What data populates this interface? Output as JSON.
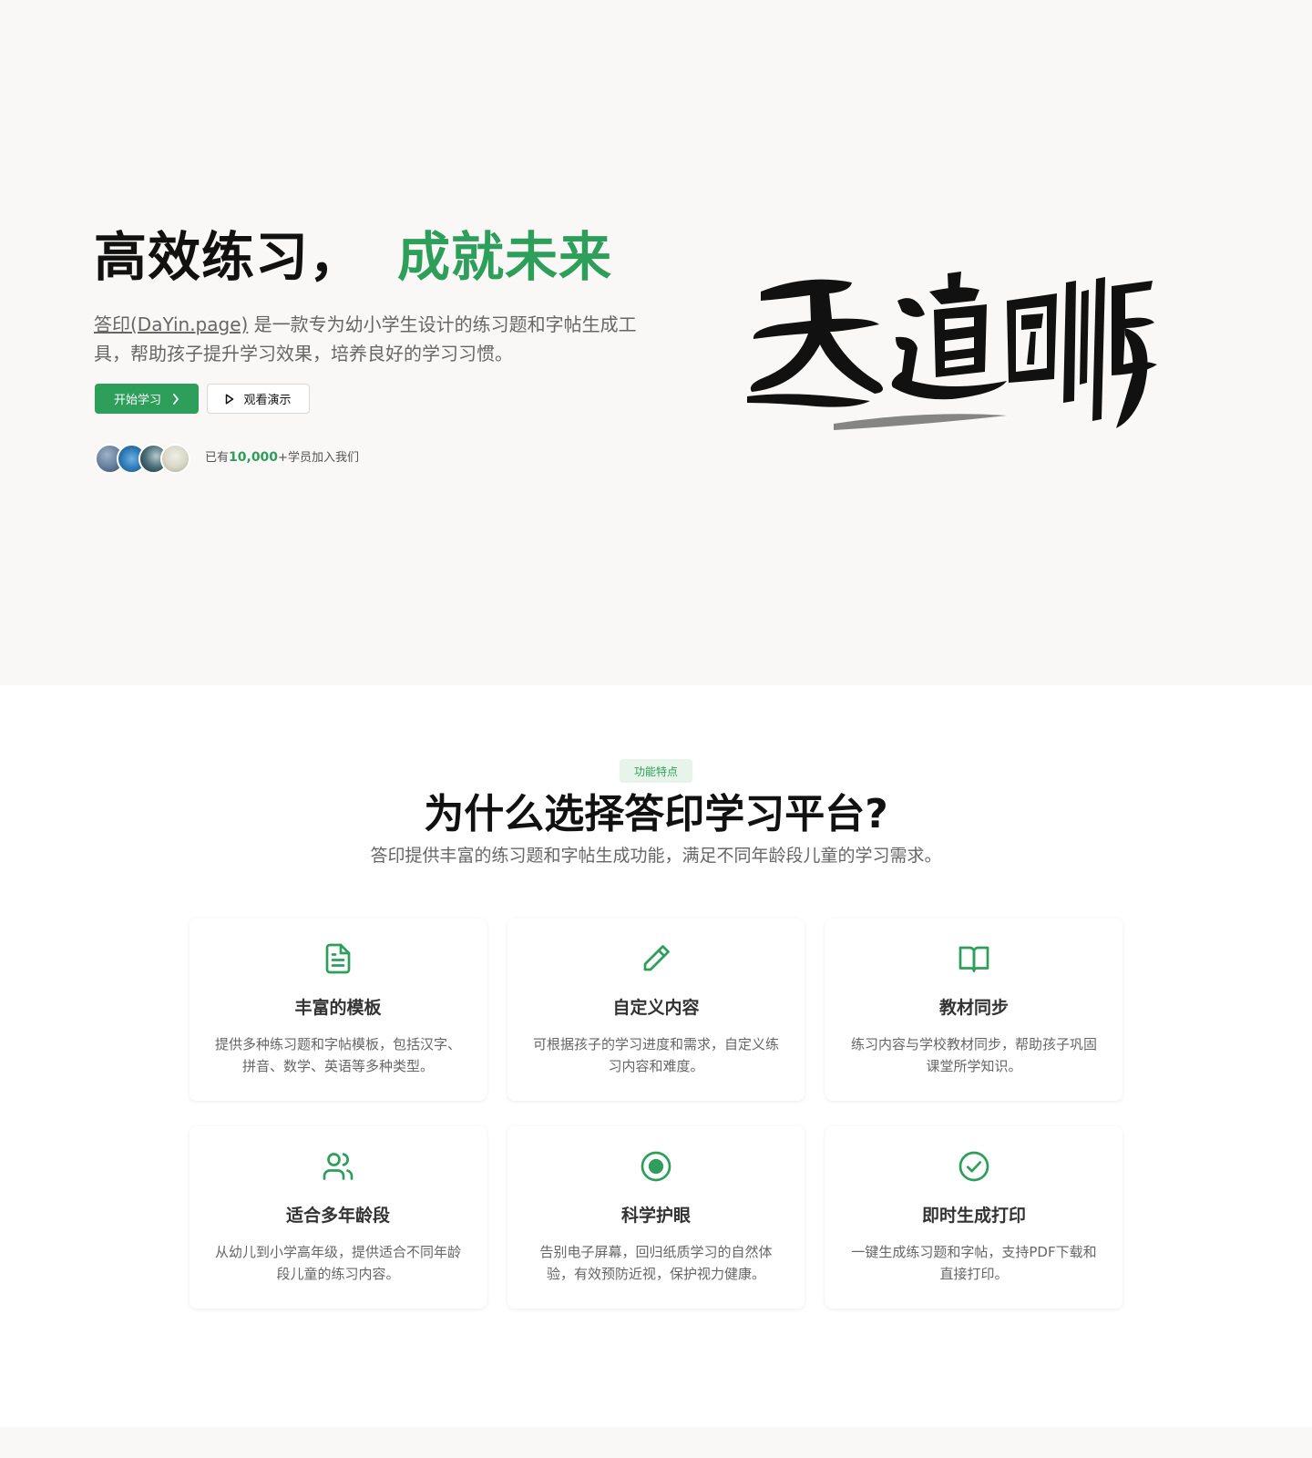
{
  "hero": {
    "title_main": "高效练习，",
    "title_accent": "成就未来",
    "brand_link": "答印(DaYin.page)",
    "description": " 是一款专为幼小学生设计的练习题和字帖生成工具，帮助孩子提升学习效果，培养良好的学习习惯。",
    "primary_button": "开始学习",
    "secondary_button": "观看演示",
    "join_prefix": "已有",
    "join_count": "10,000",
    "join_suffix": "+学员加入我们",
    "calligraphy_text": "天道酬勤",
    "accent_color": "#2e9e5b"
  },
  "features": {
    "badge": "功能特点",
    "title": "为什么选择答印学习平台?",
    "subtitle": "答印提供丰富的练习题和字帖生成功能，满足不同年龄段儿童的学习需求。",
    "cards": [
      {
        "icon": "document-icon",
        "title": "丰富的模板",
        "desc": "提供多种练习题和字帖模板，包括汉字、拼音、数学、英语等多种类型。"
      },
      {
        "icon": "pencil-icon",
        "title": "自定义内容",
        "desc": "可根据孩子的学习进度和需求，自定义练习内容和难度。"
      },
      {
        "icon": "book-icon",
        "title": "教材同步",
        "desc": "练习内容与学校教材同步，帮助孩子巩固课堂所学知识。"
      },
      {
        "icon": "users-icon",
        "title": "适合多年龄段",
        "desc": "从幼儿到小学高年级，提供适合不同年龄段儿童的练习内容。"
      },
      {
        "icon": "eye-icon",
        "title": "科学护眼",
        "desc": "告别电子屏幕，回归纸质学习的自然体验，有效预防近视，保护视力健康。"
      },
      {
        "icon": "check-circle-icon",
        "title": "即时生成打印",
        "desc": "一键生成练习题和字帖，支持PDF下载和直接打印。"
      }
    ]
  }
}
